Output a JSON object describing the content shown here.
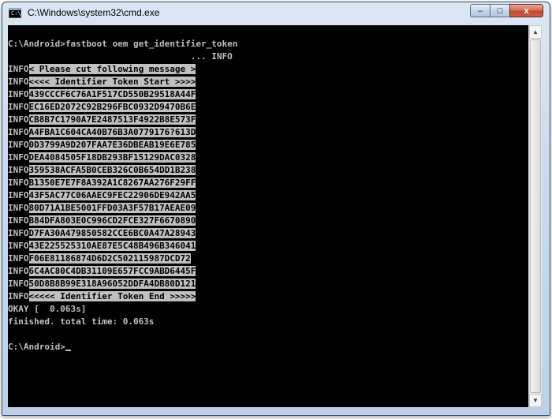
{
  "window": {
    "title": "C:\\Windows\\system32\\cmd.exe",
    "icon": "cmd-icon",
    "icon_glyph": "C:\\"
  },
  "controls": {
    "minimize": "–",
    "maximize": "□",
    "close": "x"
  },
  "scrollbar": {
    "up": "▲",
    "down": "▼"
  },
  "console": {
    "command_prompt": "C:\\Android>fastboot oem get_identifier_token",
    "info_tag": "                                   ... INFO",
    "cut_prefix": "INFO",
    "cut_message": "< Please cut following message >",
    "token_lines": [
      {
        "prefix": "INFO",
        "text": "<<<< Identifier Token Start >>>>"
      },
      {
        "prefix": "INFO",
        "text": "439CCCF6C76A1F517CD550B29518A44F"
      },
      {
        "prefix": "INFO",
        "text": "EC16ED2072C92B296FBC0932D9470B6E"
      },
      {
        "prefix": "INFO",
        "text": "CB8B7C1790A7E2487513F4922B8E573F"
      },
      {
        "prefix": "INFO",
        "text": "A4FBA1C604CA40B76B3A0779176?613D"
      },
      {
        "prefix": "INFO",
        "text": "0D3799A9D207FAA7E36DBEAB19E6E785"
      },
      {
        "prefix": "INFO",
        "text": "DEA4084505F18DB293BF15129DAC0328"
      },
      {
        "prefix": "INFO",
        "text": "359538ACFA5B0CEB326C0B654DD1B238"
      },
      {
        "prefix": "INFO",
        "text": "B1350E7E7F8A392A1C8267AA276F29FF"
      },
      {
        "prefix": "INFO",
        "text": "43F5AC77C06AAEC9FEC22906DE942AA5"
      },
      {
        "prefix": "INFO",
        "text": "80D71A1BE5001FFD03A3F57B17AEAE09"
      },
      {
        "prefix": "INFO",
        "text": "B84DFA803E0C996CD2FCE327F6670890"
      },
      {
        "prefix": "INFO",
        "text": "D7FA30A479850582CCE6BC0A47A28943"
      },
      {
        "prefix": "INFO",
        "text": "43E225525310AE87E5C48B496B346041"
      },
      {
        "prefix": "INFO",
        "text": "F06E81186874D6D2C502115987DCD72"
      },
      {
        "prefix": "INFO",
        "text": "6C4AC80C4DB31109E657FCC9ABD6445F"
      },
      {
        "prefix": "INFO",
        "text": "50D8B8B99E318A96052DDFA4DB80D121"
      },
      {
        "prefix": "INFO",
        "text": "<<<<< Identifier Token End >>>>>"
      }
    ],
    "okay_line": "OKAY [  0.063s]",
    "finished_line": "finished. total time: 0.063s",
    "final_prompt": "C:\\Android>"
  }
}
